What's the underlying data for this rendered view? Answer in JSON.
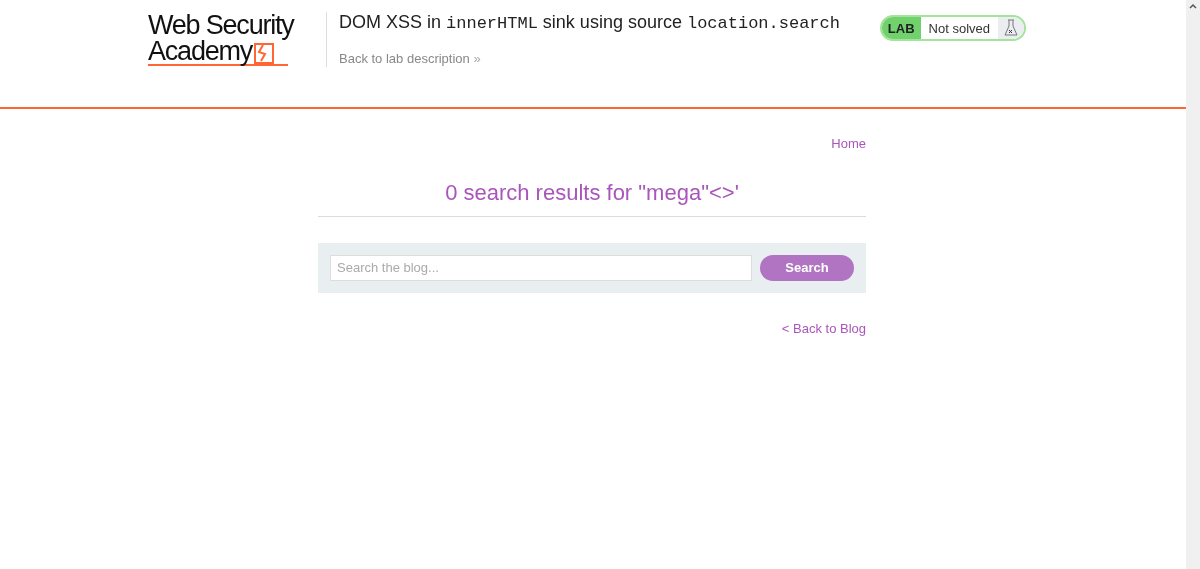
{
  "header": {
    "logo": {
      "line_1": "Web Security",
      "line_2": "Academy"
    },
    "title": [
      {
        "kind": "text",
        "text": "DOM XSS in "
      },
      {
        "kind": "code",
        "text": "innerHTML"
      },
      {
        "kind": "text",
        "text": " sink using source "
      },
      {
        "kind": "code",
        "text": "location.search"
      }
    ],
    "back_link": "Back to lab description",
    "back_chevron": "»",
    "lab_status": {
      "label": "LAB",
      "status": "Not solved",
      "solved": false
    }
  },
  "nav": {
    "home": "Home"
  },
  "results_heading": "0 search results for \"mega\"<>'",
  "search": {
    "placeholder": "Search the blog...",
    "button": "Search"
  },
  "back_to_blog": "< Back to Blog"
}
